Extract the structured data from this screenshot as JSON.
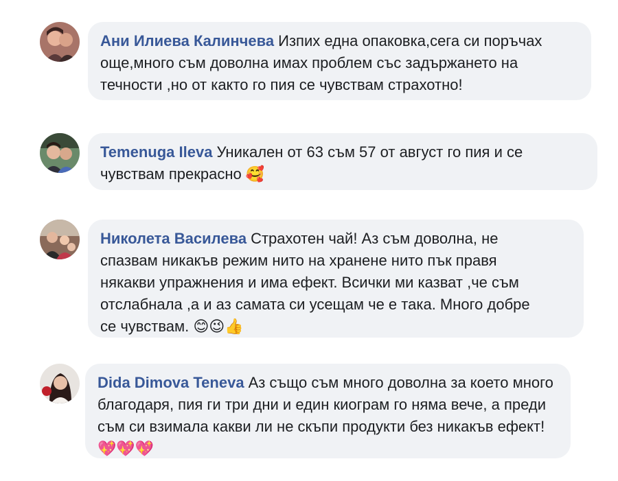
{
  "comments": [
    {
      "author": "Ани Илиева Калинчева",
      "lines": [
        "Изпих една опаковка,сега си поръчах",
        "още,много съм доволна имах проблем със задържането на",
        "течности ,но от както го пия се чувствам страхотно!"
      ],
      "emoji": ""
    },
    {
      "author": "Temenuga Ileva",
      "lines": [
        "Уникален от 63 съм 57 от август го пия и се",
        "чувствам прекрасно"
      ],
      "emoji": "🥰"
    },
    {
      "author": "Николета Василева",
      "lines": [
        "Страхотен чай! Аз съм доволна, не",
        "спазвам никакъв режим нито на хранене нито пък правя",
        "някакви упражнения и има ефект. Всички ми казват ,че съм",
        "отслабнала ,а и аз самата си усещам че е така. Много добре",
        "се чувствам."
      ],
      "emoji": "😊😉👍"
    },
    {
      "author": "Dida Dimova Teneva",
      "lines": [
        "Аз също съм много доволна за което много",
        "благодаря, пия ги три дни и един киограм го няма вече, а преди",
        "съм си взимала какви ли не скъпи продукти без никакъв ефект!",
        ""
      ],
      "emoji": "💖💖💖"
    }
  ]
}
